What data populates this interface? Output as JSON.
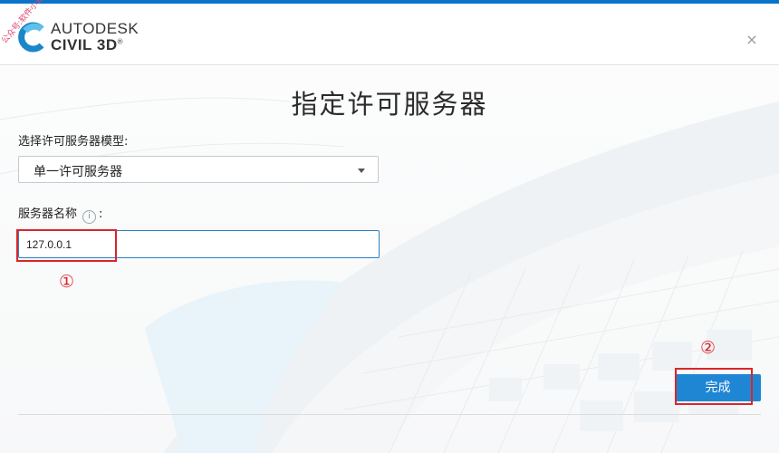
{
  "header": {
    "brand_top": "AUTODESK",
    "brand_bottom": "CIVIL 3D",
    "brand_suffix": "®",
    "watermark": "公众号:软件小哥",
    "close_icon": "close-icon",
    "close_glyph": "×"
  },
  "main": {
    "title": "指定许可服务器",
    "model_label": "选择许可服务器模型:",
    "model_selected": "单一许可服务器",
    "server_label": "服务器名称",
    "server_label_suffix": ":",
    "info_glyph": "i",
    "server_value": "127.0.0.1"
  },
  "annotations": {
    "marker_1": "①",
    "marker_2": "②"
  },
  "footer": {
    "finish_label": "完成"
  },
  "colors": {
    "accent": "#1f86d4",
    "highlight": "#d9262b",
    "top_strip": "#0b74c8"
  }
}
